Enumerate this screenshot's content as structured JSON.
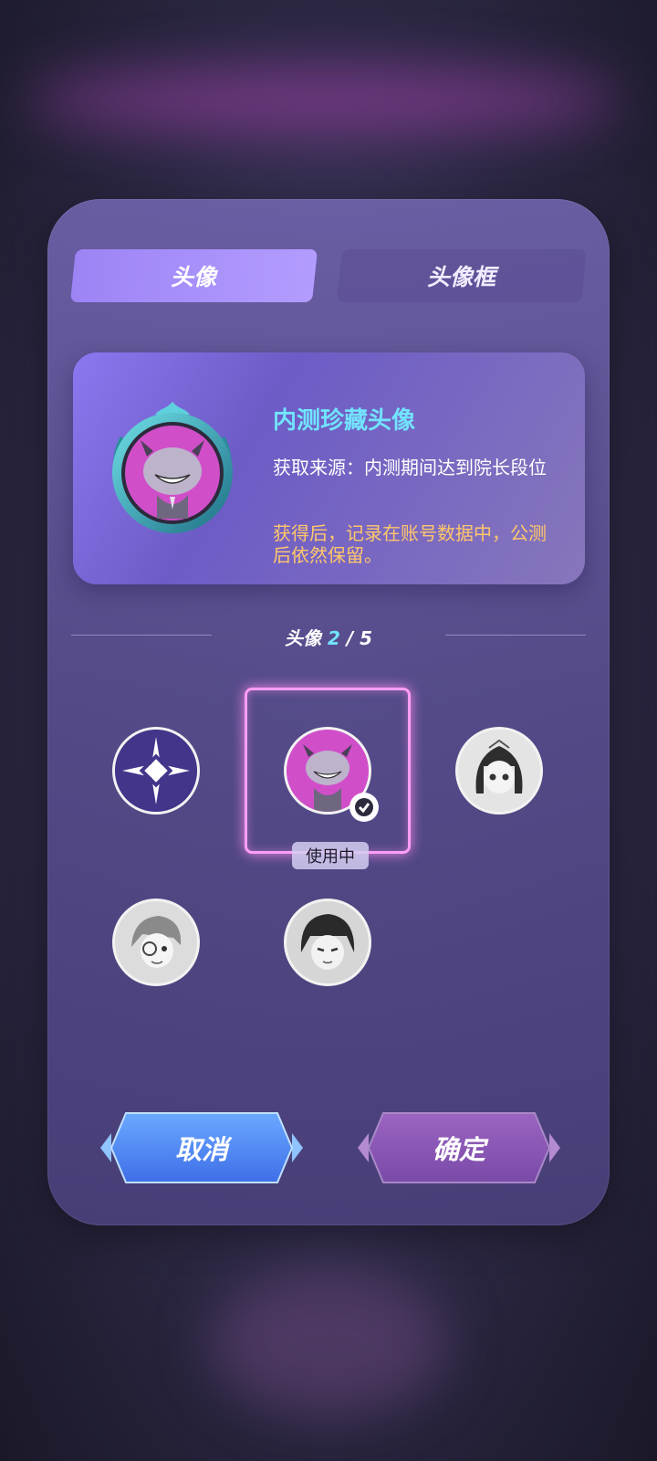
{
  "tabs": [
    {
      "label": "头像",
      "active": true
    },
    {
      "label": "头像框",
      "active": false
    }
  ],
  "info": {
    "title": "内测珍藏头像",
    "source": "获取来源：内测期间达到院长段位",
    "note": "获得后，记录在账号数据中，公测后依然保留。"
  },
  "grid": {
    "label": "头像",
    "current": "2",
    "separator": "/",
    "total": "5",
    "status_label": "使用中"
  },
  "avatars": [
    {
      "name": "star-emblem-avatar",
      "locked": false
    },
    {
      "name": "grinning-monster-avatar",
      "selected": true
    },
    {
      "name": "dark-hair-girl-avatar",
      "locked": true
    },
    {
      "name": "monocle-boy-avatar",
      "locked": true
    },
    {
      "name": "dark-hair-man-avatar",
      "locked": true
    }
  ],
  "buttons": {
    "cancel": "取消",
    "confirm": "确定"
  },
  "colors": {
    "accent_cyan": "#72e4ff",
    "note_orange": "#ffc76b",
    "active_tab": "#9d84f5",
    "selection_pink": "#ff9ef5",
    "cancel_blue": "#4f8df5",
    "confirm_purple": "#8a55b0"
  }
}
